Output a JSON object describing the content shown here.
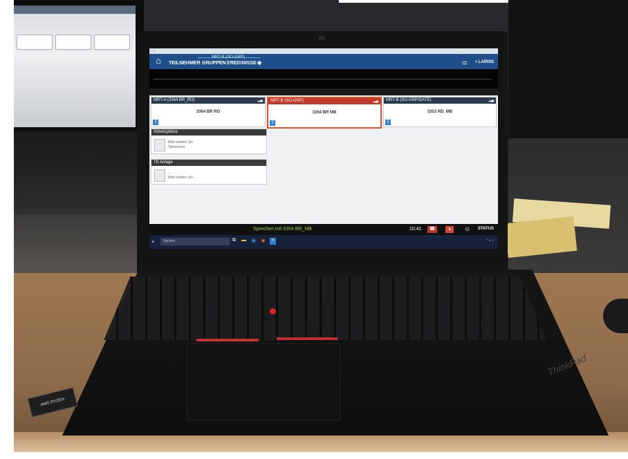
{
  "app": {
    "window_title": "MRT-B (SO-GRP)",
    "tabs": [
      "TEILNEHMER",
      "GRUPPEN",
      "EREIGNISSE"
    ],
    "brand": "LARDIS"
  },
  "cards": [
    {
      "header": "MRT-A (3364 BR_RO)",
      "body": "3364 BR RO",
      "badge": "2"
    },
    {
      "header": "MRT-B (SO-GRP)",
      "body": "3354 BR MB",
      "badge": "2"
    },
    {
      "header": "MRT-B (SO-GRP/GATE)",
      "body": "3353 RD_MB",
      "badge": "2"
    }
  ],
  "panels": [
    {
      "title": "Arbeitsplätze",
      "line1": "Bitte wählen Sie",
      "line2": "Teilnehmer"
    },
    {
      "title": "TK Anlage",
      "line1": "...",
      "line2": "Bitte wählen Sie..."
    }
  ],
  "status": {
    "message": "Sprechen mit 3354 BR_MB",
    "time": "10:41",
    "status_label": "STATUS"
  },
  "taskbar": {
    "search_placeholder": "Suchen"
  },
  "laptop": {
    "brand": "ThinkPad",
    "sticker": "AMD RYZEN"
  }
}
